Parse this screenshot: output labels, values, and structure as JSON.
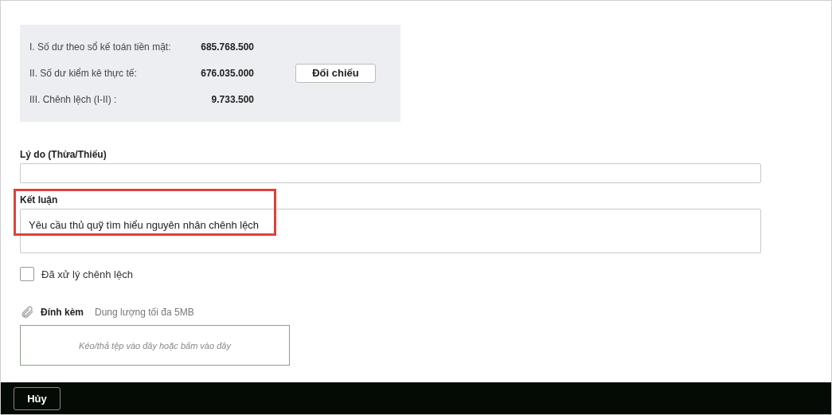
{
  "summary": {
    "rows": [
      {
        "label": "I. Số dư theo sổ kế toán tiền mặt:",
        "value": "685.768.500"
      },
      {
        "label": "II. Số dư kiểm kê thực tế:",
        "value": "676.035.000"
      },
      {
        "label": "III. Chênh lệch (I-II) :",
        "value": "9.733.500"
      }
    ],
    "button": "Đối chiếu"
  },
  "reason": {
    "label": "Lý do (Thừa/Thiếu)"
  },
  "conclusion": {
    "label": "Kết luận",
    "value": "Yêu cầu thủ quỹ tìm hiểu nguyên nhân chênh lệch",
    "highlighted": true
  },
  "resolved": {
    "label": "Đã xử lý chênh lệch",
    "checked": false
  },
  "attachment": {
    "label": "Đính kèm",
    "hint": "Dung lượng tối đa 5MB",
    "dropzone": "Kéo/thả tệp vào đây hoặc bấm vào đây"
  },
  "footer": {
    "cancel": "Hủy"
  }
}
